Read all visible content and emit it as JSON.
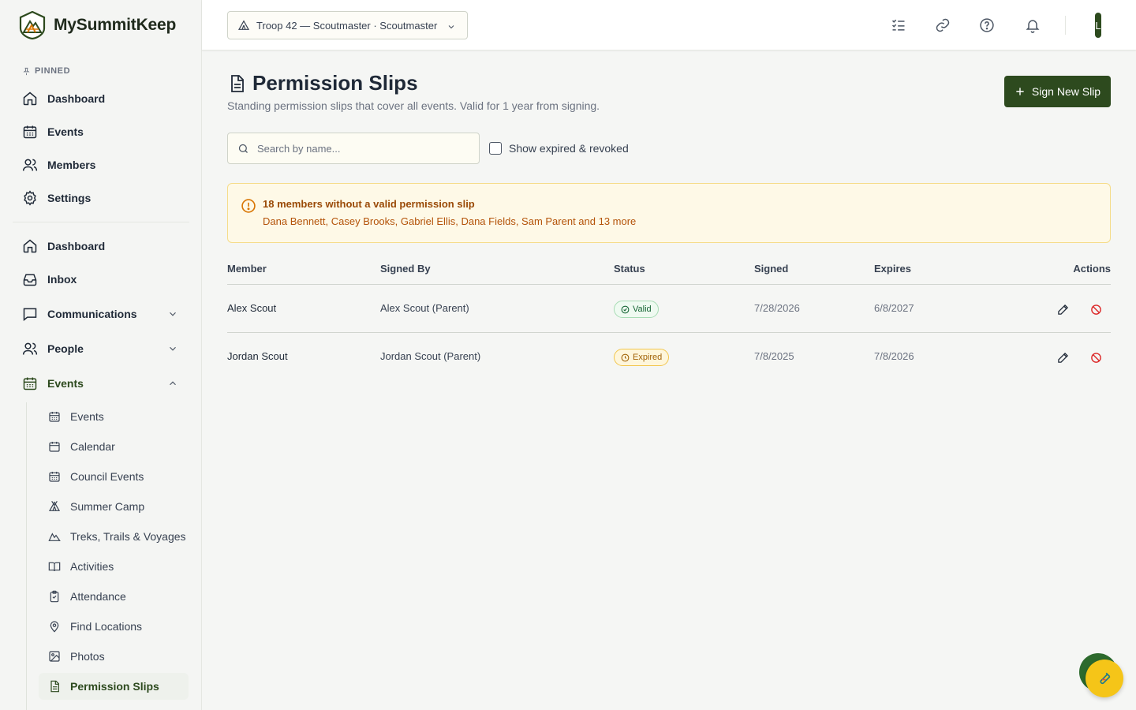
{
  "brand": {
    "name": "MySummitKeep"
  },
  "sidebar": {
    "pinned_label": "PINNED",
    "pinned": [
      {
        "label": "Dashboard",
        "icon": "home-icon"
      },
      {
        "label": "Events",
        "icon": "calendar-icon"
      },
      {
        "label": "Members",
        "icon": "users-icon"
      },
      {
        "label": "Settings",
        "icon": "gear-icon"
      }
    ],
    "main": [
      {
        "label": "Dashboard",
        "icon": "home-icon"
      },
      {
        "label": "Inbox",
        "icon": "inbox-icon"
      },
      {
        "label": "Communications",
        "icon": "chat-icon",
        "expanded": false
      },
      {
        "label": "People",
        "icon": "users-icon",
        "expanded": false
      },
      {
        "label": "Events",
        "icon": "calendar-icon",
        "expanded": true
      }
    ],
    "events_sub": [
      {
        "label": "Events",
        "icon": "calendar-icon"
      },
      {
        "label": "Calendar",
        "icon": "calendar-icon"
      },
      {
        "label": "Council Events",
        "icon": "calendar-icon"
      },
      {
        "label": "Summer Camp",
        "icon": "tent-icon"
      },
      {
        "label": "Treks, Trails & Voyages",
        "icon": "mountain-icon"
      },
      {
        "label": "Activities",
        "icon": "book-icon"
      },
      {
        "label": "Attendance",
        "icon": "clipboard-icon"
      },
      {
        "label": "Find Locations",
        "icon": "map-pin-icon"
      },
      {
        "label": "Photos",
        "icon": "image-icon"
      },
      {
        "label": "Permission Slips",
        "icon": "document-icon",
        "active": true
      }
    ]
  },
  "topbar": {
    "troop_selector": "Troop 42 — Scoutmaster · Scoutmaster",
    "avatar_initial": "L"
  },
  "page": {
    "title": "Permission Slips",
    "subtitle": "Standing permission slips that cover all events. Valid for 1 year from signing.",
    "sign_button": "Sign New Slip",
    "search_placeholder": "Search by name...",
    "show_expired_label": "Show expired & revoked",
    "show_expired_checked": false
  },
  "alert": {
    "title": "18 members without a valid permission slip",
    "names": "Dana Bennett, Casey Brooks, Gabriel Ellis, Dana Fields, Sam Parent and 13 more"
  },
  "table": {
    "headers": {
      "member": "Member",
      "signed_by": "Signed By",
      "status": "Status",
      "signed": "Signed",
      "expires": "Expires",
      "actions": "Actions"
    },
    "rows": [
      {
        "member": "Alex Scout",
        "signed_by": "Alex Scout (Parent)",
        "status": "Valid",
        "signed": "7/28/2026",
        "expires": "6/8/2027"
      },
      {
        "member": "Jordan Scout",
        "signed_by": "Jordan Scout (Parent)",
        "status": "Expired",
        "signed": "7/8/2025",
        "expires": "7/8/2026"
      }
    ]
  },
  "colors": {
    "brand": "#2d4a1e",
    "valid": "#166534",
    "expired": "#a16207",
    "alert_bg": "#fef9e7",
    "revoke": "#dc2626",
    "fab": "#f5c518"
  }
}
